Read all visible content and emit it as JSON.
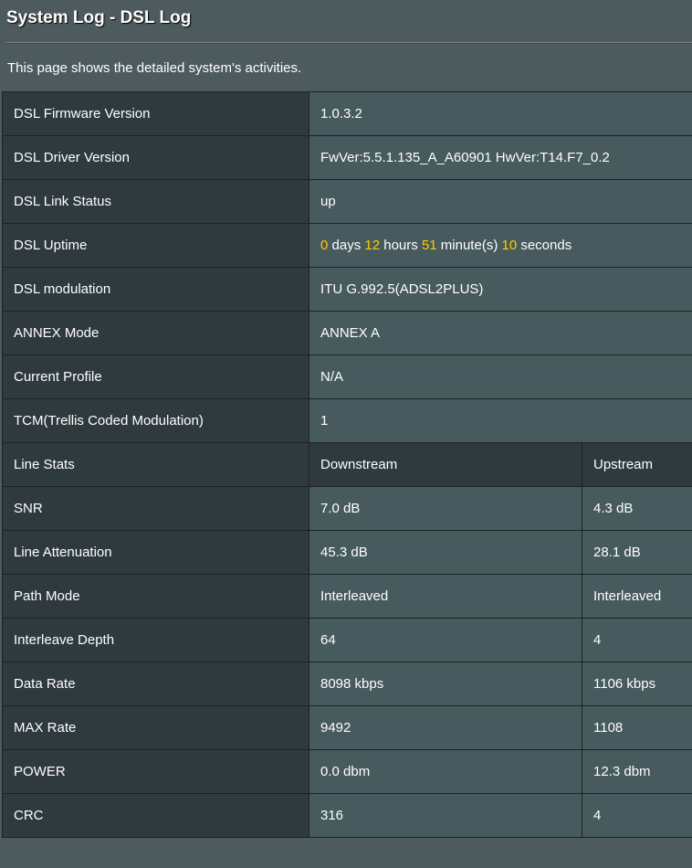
{
  "header": {
    "title": "System Log - DSL Log",
    "description": "This page shows the detailed system's activities."
  },
  "info_rows": [
    {
      "label": "DSL Firmware Version",
      "value": "1.0.3.2"
    },
    {
      "label": "DSL Driver Version",
      "value": "FwVer:5.5.1.135_A_A60901 HwVer:T14.F7_0.2"
    },
    {
      "label": "DSL Link Status",
      "value": "up"
    },
    {
      "label": "DSL Uptime",
      "value": ""
    },
    {
      "label": "DSL modulation",
      "value": "ITU G.992.5(ADSL2PLUS)"
    },
    {
      "label": "ANNEX Mode",
      "value": "ANNEX A"
    },
    {
      "label": "Current Profile",
      "value": "N/A"
    },
    {
      "label": "TCM(Trellis Coded Modulation)",
      "value": "1"
    }
  ],
  "uptime": {
    "days": "0",
    "days_unit": "days",
    "hours": "12",
    "hours_unit": "hours",
    "minutes": "51",
    "minutes_unit": "minute(s)",
    "seconds": "10",
    "seconds_unit": "seconds"
  },
  "line_stats": {
    "header_label": "Line Stats",
    "downstream_label": "Downstream",
    "upstream_label": "Upstream",
    "rows": [
      {
        "label": "SNR",
        "downstream": "7.0 dB",
        "upstream": "4.3 dB"
      },
      {
        "label": "Line Attenuation",
        "downstream": "45.3 dB",
        "upstream": "28.1 dB"
      },
      {
        "label": "Path Mode",
        "downstream": "Interleaved",
        "upstream": "Interleaved"
      },
      {
        "label": "Interleave Depth",
        "downstream": "64",
        "upstream": "4"
      },
      {
        "label": "Data Rate",
        "downstream": "8098 kbps",
        "upstream": "1106 kbps"
      },
      {
        "label": "MAX Rate",
        "downstream": "9492",
        "upstream": "1108"
      },
      {
        "label": "POWER",
        "downstream": "0.0 dbm",
        "upstream": "12.3 dbm"
      },
      {
        "label": "CRC",
        "downstream": "316",
        "upstream": "4"
      }
    ]
  },
  "colors": {
    "background": "#4d5a5e",
    "label_cell": "#2f3a3e",
    "value_cell": "#475a5e",
    "highlight": "#ffcc00"
  }
}
